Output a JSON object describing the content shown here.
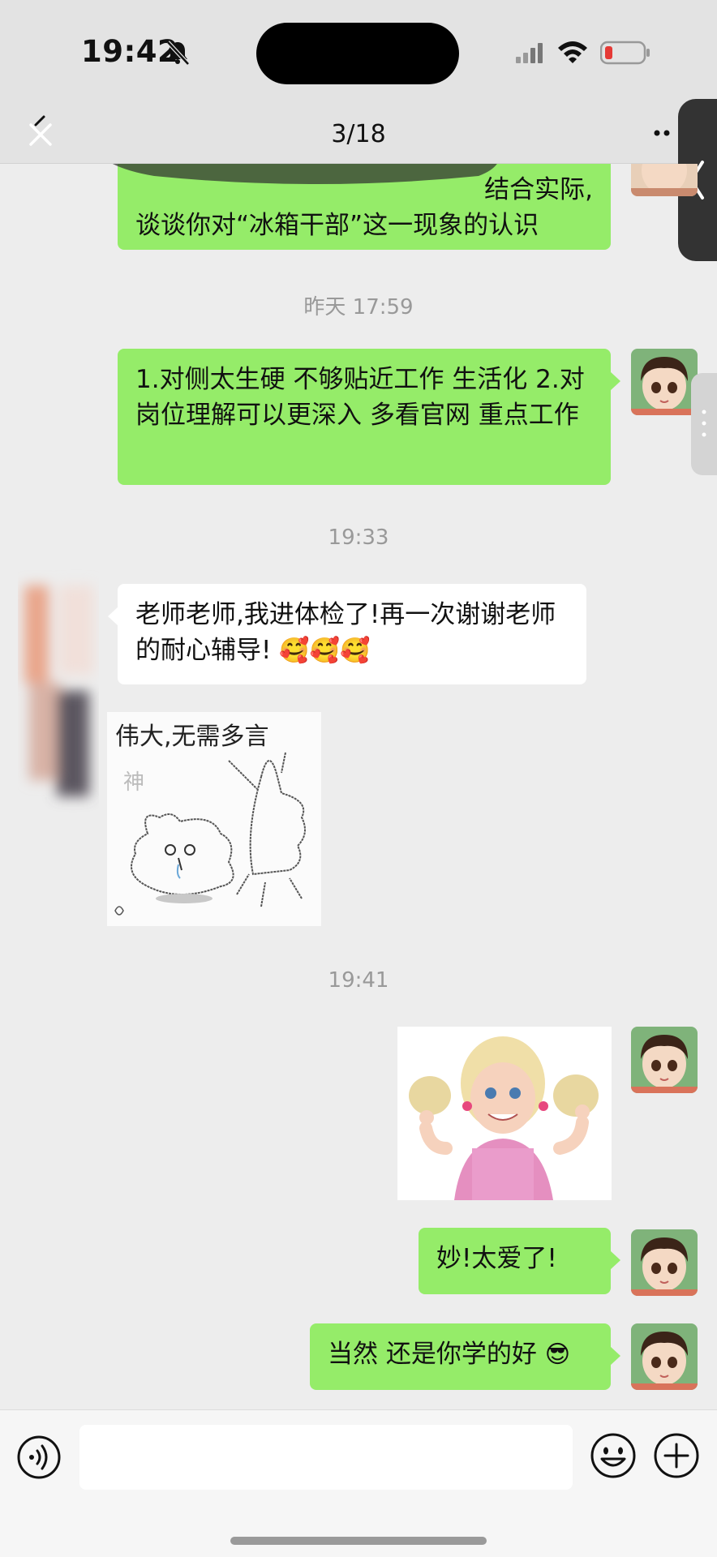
{
  "status_bar": {
    "time": "19:42"
  },
  "nav": {
    "counter": "3/18"
  },
  "messages": {
    "m1": {
      "text_line1": "结合实际,",
      "text_line2": "谈谈你对“冰箱干部”这一现象的认识"
    },
    "ts1": "昨天 17:59",
    "m2": {
      "text": "1.对侧太生硬 不够贴近工作 生活化 2.对岗位理解可以更深入 多看官网 重点工作"
    },
    "ts2": "19:33",
    "m3": {
      "text": "老师老师,我进体检了!再一次谢谢老师的耐心辅导!",
      "emojis": "🥰🥰🥰"
    },
    "sticker1": {
      "text": "伟大,无需多言",
      "subtext": "神"
    },
    "ts3": "19:41",
    "m5": {
      "text": "妙!太爱了!"
    },
    "m6": {
      "text": "当然 还是你学的好",
      "emoji": "😎"
    }
  },
  "icons": {
    "bell": "bell-slash-icon",
    "signal": "cellular-signal-icon",
    "wifi": "wifi-icon",
    "battery": "battery-low-icon",
    "back": "close-icon",
    "more": "more-dots-icon",
    "voice": "voice-input-icon",
    "emoji": "emoji-icon",
    "add": "plus-icon"
  },
  "colors": {
    "my_bubble": "#95ec69",
    "other_bubble": "#ffffff",
    "background": "#ededed",
    "battery_low": "#e53935"
  }
}
